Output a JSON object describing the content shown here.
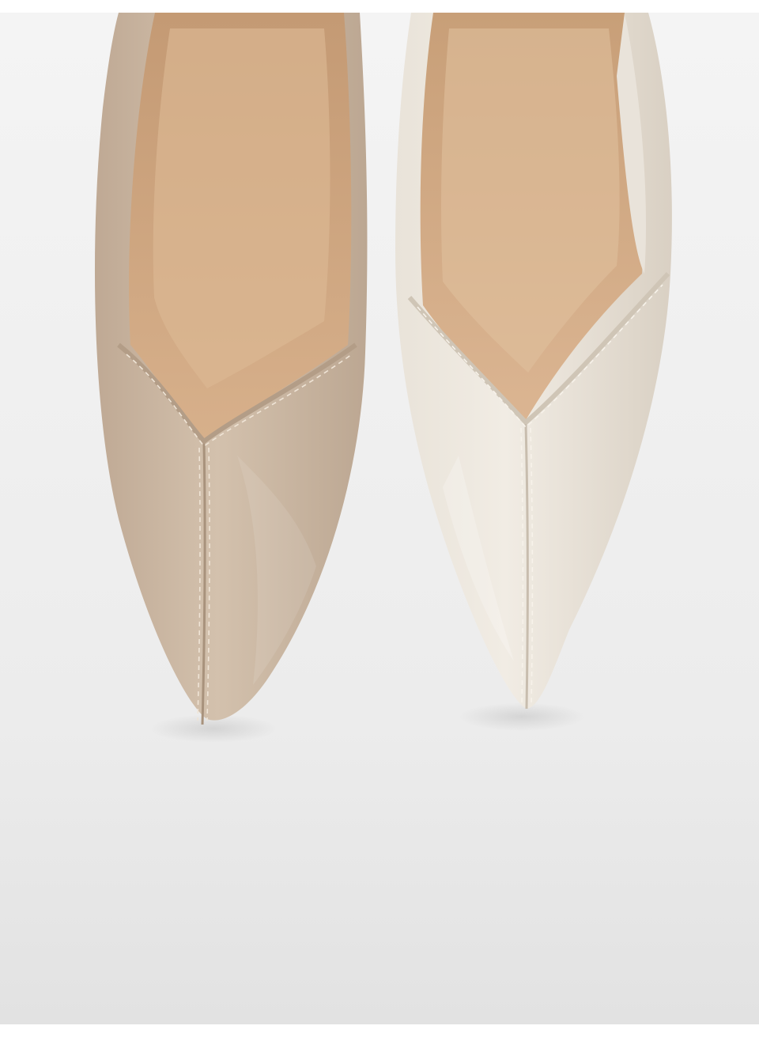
{
  "photo": {
    "alt_subject": "pair-of-pointed-toe-pumps",
    "colors": {
      "backdrop_light": "#f3f3f3",
      "backdrop_mid": "#ebebeb",
      "backdrop_dark": "#e1e1e1",
      "left_shoe_upper": "#c9b7a2",
      "left_shoe_shadow": "#b29e88",
      "left_shoe_lining": "#cfa57e",
      "right_shoe_upper": "#e4ddd1",
      "right_shoe_shadow": "#cfc6b8",
      "right_shoe_lining": "#d2a982",
      "stitching_left": "#efe4d6",
      "stitching_right": "#f6f1ea"
    }
  }
}
